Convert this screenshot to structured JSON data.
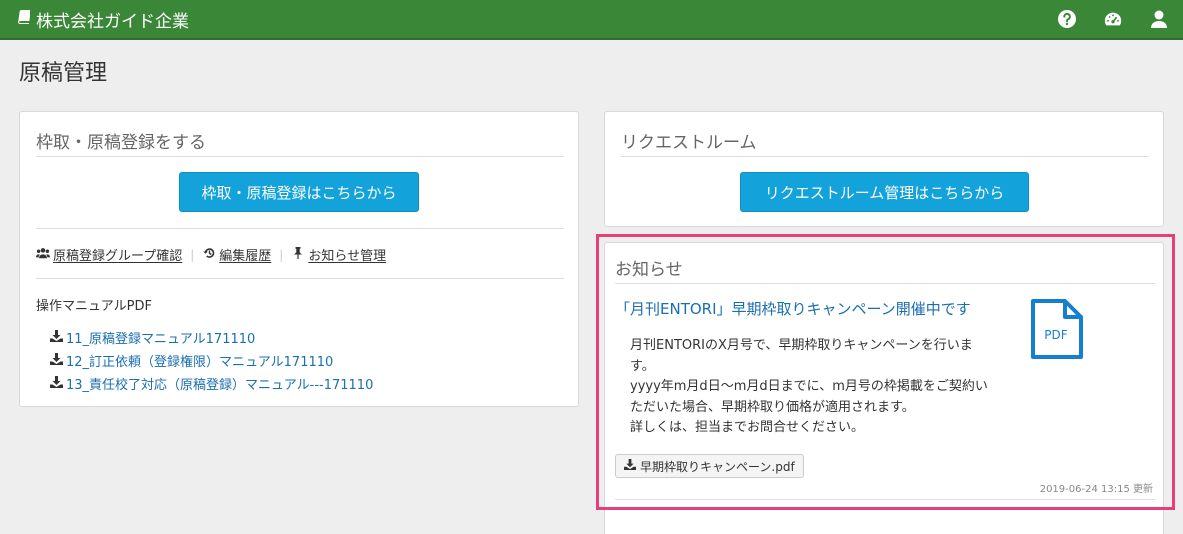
{
  "navbar": {
    "brand": "株式会社ガイド企業",
    "icons": [
      "book-icon",
      "help-icon",
      "dashboard-icon",
      "user-icon"
    ],
    "color": "#3a8837"
  },
  "page": {
    "title": "原稿管理"
  },
  "left_panel": {
    "title": "枠取・原稿登録をする",
    "button_label": "枠取・原稿登録はこちらから",
    "links": [
      {
        "label": "原稿登録グループ確認",
        "icon": "users-icon"
      },
      {
        "label": "編集履歴",
        "icon": "history-icon"
      },
      {
        "label": "お知らせ管理",
        "icon": "pin-icon"
      }
    ],
    "manual_title": "操作マニュアルPDF",
    "manuals": [
      "11_原稿登録マニュアル171110",
      "12_訂正依頼（登録権限）マニュアル171110",
      "13_責任校了対応（原稿登録）マニュアル---171110"
    ]
  },
  "right_panel": {
    "title": "リクエストルーム",
    "button_label": "リクエストルーム管理はこちらから"
  },
  "news_panel": {
    "title": "お知らせ",
    "headline": "「月刊ENTORI」早期枠取りキャンペーン開催中です",
    "body_lines": [
      "月刊ENTORIのX月号で、早期枠取りキャンペーンを行いま",
      "す。",
      "yyyy年m月d日〜m月d日までに、m月号の枠掲載をご契約い",
      "ただいた場合、早期枠取り価格が適用されます。",
      "詳しくは、担当までお問合せください。"
    ],
    "pdf_icon_label": "PDF",
    "attachment": "早期枠取りキャンペーン.pdf",
    "updated": "2019-06-24 13:15 更新"
  },
  "colors": {
    "primary": "#13a3da",
    "link": "#1a6fb0",
    "highlight": "#e5407c"
  }
}
